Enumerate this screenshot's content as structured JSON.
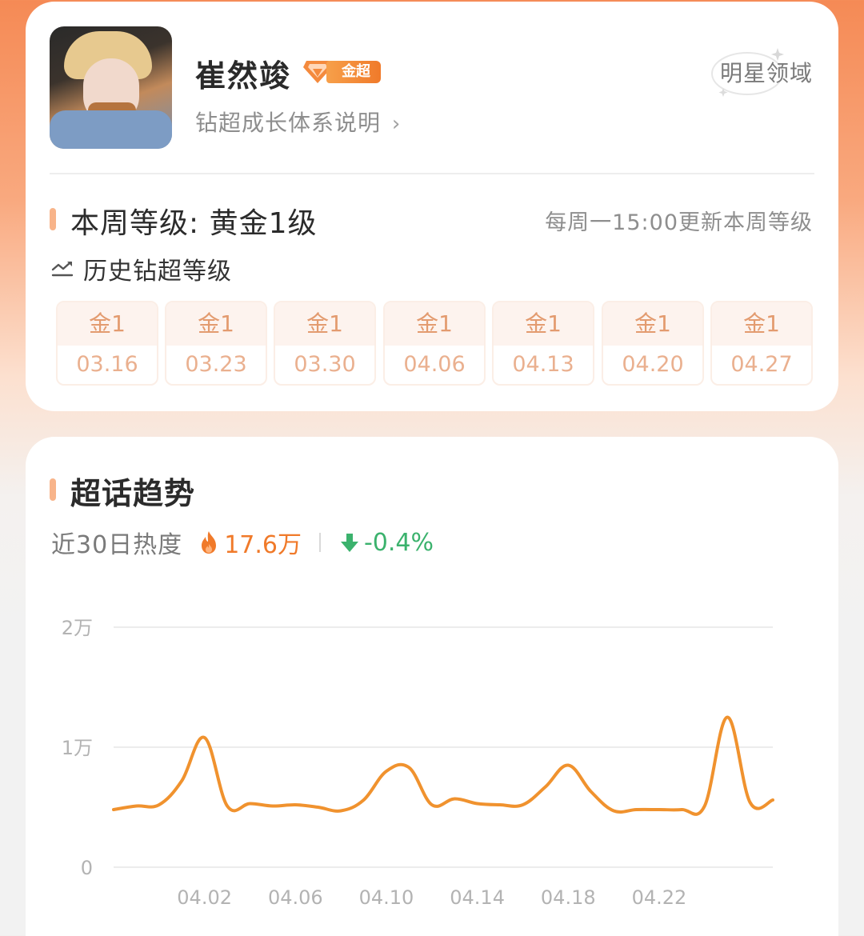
{
  "profile": {
    "name": "崔然竣",
    "badge_label": "金超",
    "growth_link": "钻超成长体系说明",
    "chevron": "chevron-right-icon",
    "star_domain": "明星领域"
  },
  "level": {
    "week_title": "本周等级: 黄金1级",
    "update_note": "每周一15:00更新本周等级",
    "history_label": "历史钻超等级",
    "history": [
      {
        "level": "金1",
        "date": "03.16"
      },
      {
        "level": "金1",
        "date": "03.23"
      },
      {
        "level": "金1",
        "date": "03.30"
      },
      {
        "level": "金1",
        "date": "04.06"
      },
      {
        "level": "金1",
        "date": "04.13"
      },
      {
        "level": "金1",
        "date": "04.20"
      },
      {
        "level": "金1",
        "date": "04.27"
      }
    ]
  },
  "trend": {
    "title": "超话趋势",
    "heat_label": "近30日热度",
    "heat_value": "17.6万",
    "change_value": "-0.4%"
  },
  "colors": {
    "accent": "#f07a2a",
    "line": "#f0922e",
    "positive_down": "#3bb26d"
  },
  "chart_data": {
    "type": "line",
    "title": "",
    "xlabel": "",
    "ylabel": "",
    "ylim": [
      0,
      20000
    ],
    "yticks": [
      {
        "value": 0,
        "label": "0"
      },
      {
        "value": 10000,
        "label": "1万"
      },
      {
        "value": 20000,
        "label": "2万"
      }
    ],
    "xticks": [
      "04.02",
      "04.06",
      "04.10",
      "04.14",
      "04.18",
      "04.22"
    ],
    "grid": true,
    "series": [
      {
        "x": [
          "03.29",
          "03.30",
          "03.31",
          "04.01",
          "04.02",
          "04.03",
          "04.04",
          "04.05",
          "04.06",
          "04.07",
          "04.08",
          "04.09",
          "04.10",
          "04.11",
          "04.12",
          "04.13",
          "04.14",
          "04.15",
          "04.16",
          "04.17",
          "04.18",
          "04.19",
          "04.20",
          "04.21",
          "04.22",
          "04.23",
          "04.24",
          "04.25",
          "04.26",
          "04.27"
        ],
        "values": [
          4800,
          5100,
          5200,
          7200,
          10800,
          5100,
          5300,
          5100,
          5200,
          5000,
          4700,
          5600,
          8000,
          8300,
          5200,
          5700,
          5300,
          5200,
          5200,
          6700,
          8500,
          6300,
          4700,
          4800,
          4800,
          4800,
          5100,
          12500,
          5400,
          5600
        ]
      }
    ]
  }
}
